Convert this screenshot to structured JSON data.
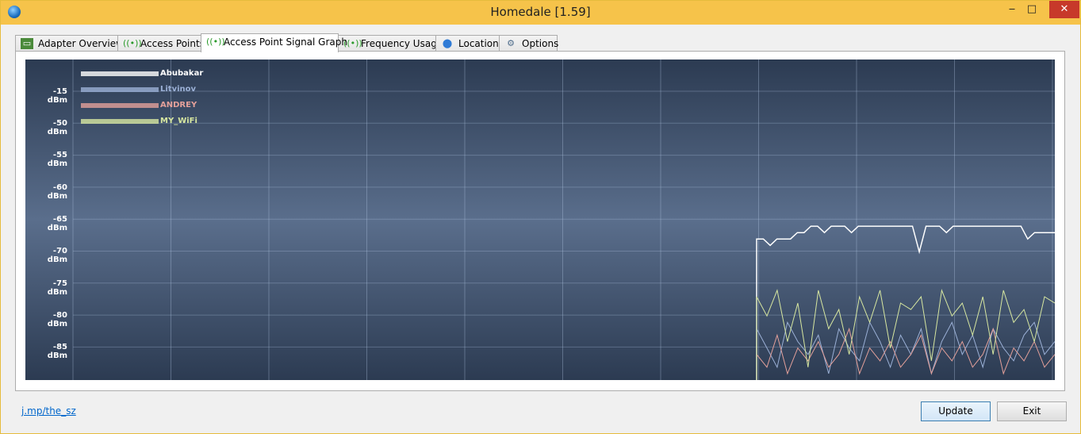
{
  "window": {
    "title": "Homedale [1.59]",
    "min_icon": "minimize-icon",
    "max_icon": "maximize-icon",
    "close_icon": "close-icon"
  },
  "tabs": [
    {
      "label": "Adapter Overview",
      "icon": "network-card-icon"
    },
    {
      "label": "Access Points",
      "icon": "wifi-signal-icon"
    },
    {
      "label": "Access Point Signal Graph",
      "icon": "wifi-signal-icon",
      "active": true
    },
    {
      "label": "Frequency Usage",
      "icon": "wifi-signal-icon"
    },
    {
      "label": "Location",
      "icon": "map-pin-icon"
    },
    {
      "label": "Options",
      "icon": "settings-icon"
    }
  ],
  "graph": {
    "y_labels": [
      "-15 dBm",
      "-50 dBm",
      "-55 dBm",
      "-60 dBm",
      "-65 dBm",
      "-70 dBm",
      "-75 dBm",
      "-80 dBm",
      "-85 dBm"
    ],
    "legend": [
      {
        "name": "Abubakar",
        "color": "#ffffff"
      },
      {
        "name": "Litvinov",
        "color": "#9bb0d6"
      },
      {
        "name": "ANDREY",
        "color": "#e3a09a"
      },
      {
        "name": "MY_WiFi",
        "color": "#d7e7a0"
      }
    ]
  },
  "chart_data": {
    "type": "line",
    "ylabel": "",
    "y_ticks": [
      "-15 dBm",
      "-50 dBm",
      "-55 dBm",
      "-60 dBm",
      "-65 dBm",
      "-70 dBm",
      "-75 dBm",
      "-80 dBm",
      "-85 dBm"
    ],
    "ylim": [
      -90,
      -40
    ],
    "grid": true,
    "legend_position": "top-left",
    "series": [
      {
        "name": "Abubakar",
        "values": [
          -68,
          -68,
          -69,
          -68,
          -68,
          -68,
          -67,
          -67,
          -66,
          -66,
          -67,
          -66,
          -66,
          -66,
          -67,
          -66,
          -66,
          -66,
          -66,
          -66,
          -66,
          -66,
          -66,
          -66,
          -70,
          -66,
          -66,
          -66,
          -67,
          -66,
          -66,
          -66,
          -66,
          -66,
          -66,
          -66,
          -66,
          -66,
          -66,
          -66,
          -68,
          -67,
          -67,
          -67,
          -67
        ]
      },
      {
        "name": "Litvinov",
        "values": [
          -82,
          -85,
          -88,
          -81,
          -84,
          -86,
          -83,
          -89,
          -82,
          -85,
          -87,
          -81,
          -84,
          -88,
          -83,
          -86,
          -82,
          -89,
          -84,
          -81,
          -86,
          -83,
          -88,
          -82,
          -85,
          -87,
          -83,
          -81,
          -86,
          -84
        ]
      },
      {
        "name": "ANDREY",
        "values": [
          -86,
          -88,
          -83,
          -89,
          -85,
          -87,
          -84,
          -88,
          -86,
          -82,
          -89,
          -85,
          -87,
          -84,
          -88,
          -86,
          -83,
          -89,
          -85,
          -87,
          -84,
          -88,
          -86,
          -82,
          -89,
          -85,
          -87,
          -84,
          -88,
          -86
        ]
      },
      {
        "name": "MY_WiFi",
        "values": [
          -77,
          -80,
          -76,
          -84,
          -78,
          -88,
          -76,
          -82,
          -79,
          -86,
          -77,
          -81,
          -76,
          -85,
          -78,
          -79,
          -77,
          -87,
          -76,
          -80,
          -78,
          -83,
          -77,
          -86,
          -76,
          -81,
          -79,
          -84,
          -77,
          -78
        ]
      }
    ]
  },
  "footer": {
    "link": "j.mp/the_sz",
    "update_label": "Update",
    "exit_label": "Exit"
  }
}
